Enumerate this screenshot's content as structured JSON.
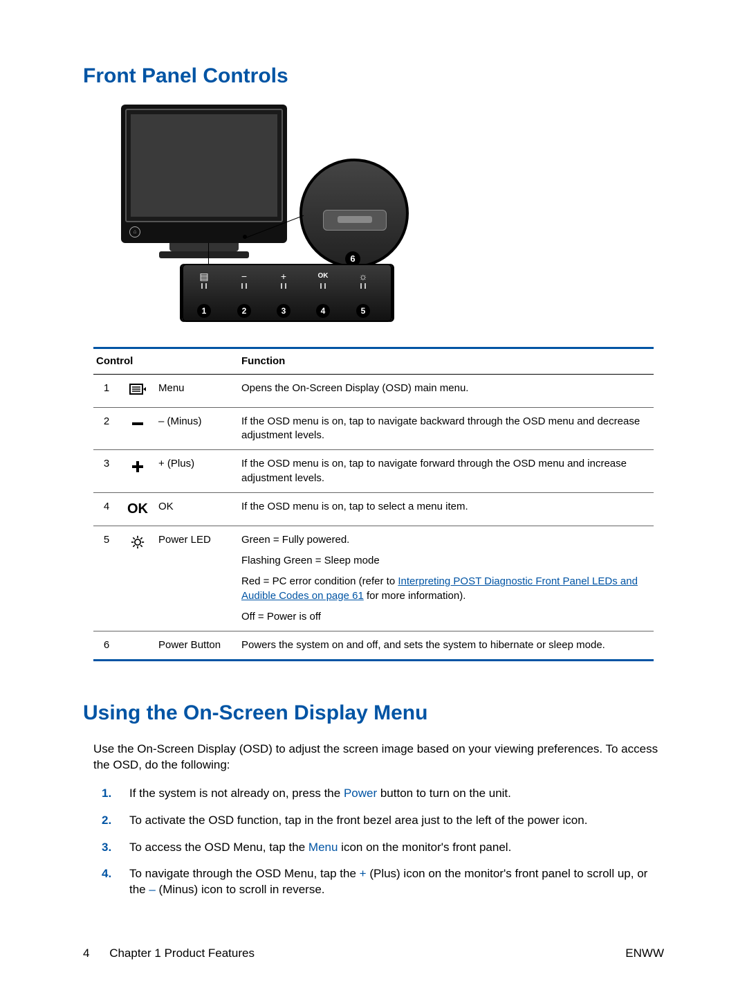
{
  "headings": {
    "h1": "Front Panel Controls",
    "h2": "Using the On-Screen Display Menu"
  },
  "figure": {
    "badges": [
      "1",
      "2",
      "3",
      "4",
      "5",
      "6"
    ],
    "strip_glyphs": [
      "menu",
      "−",
      "+",
      "OK",
      "power-led"
    ]
  },
  "table": {
    "headers": {
      "control": "Control",
      "function": "Function"
    },
    "rows": [
      {
        "num": "1",
        "icon": "menu-icon",
        "name": "Menu",
        "functions": [
          "Opens the On-Screen Display (OSD) main menu."
        ]
      },
      {
        "num": "2",
        "icon": "minus-icon",
        "name": "– (Minus)",
        "functions": [
          "If the OSD menu is on, tap to navigate backward through the OSD menu and decrease adjustment levels."
        ]
      },
      {
        "num": "3",
        "icon": "plus-icon",
        "name": "+ (Plus)",
        "functions": [
          "If the OSD menu is on, tap to navigate forward through the OSD menu and increase adjustment levels."
        ]
      },
      {
        "num": "4",
        "icon": "ok-icon",
        "icon_text": "OK",
        "name": "OK",
        "functions": [
          "If the OSD menu is on, tap to select a menu item."
        ]
      },
      {
        "num": "5",
        "icon": "power-led-icon",
        "name": "Power LED",
        "functions": [
          "Green = Fully powered.",
          "Flashing Green = Sleep mode",
          "",
          "Off = Power is off"
        ],
        "linked_function": {
          "pre": "Red = PC error condition (refer to ",
          "link": "Interpreting POST Diagnostic Front Panel LEDs and Audible Codes on page 61",
          "post": " for more information)."
        }
      },
      {
        "num": "6",
        "icon": "",
        "name": "Power Button",
        "functions": [
          "Powers the system on and off, and sets the system to hibernate or sleep mode."
        ]
      }
    ]
  },
  "osd": {
    "intro": "Use the On-Screen Display (OSD) to adjust the screen image based on your viewing preferences. To access the OSD, do the following:",
    "steps": [
      {
        "pre": "If the system is not already on, press the ",
        "kw": "Power",
        "post": " button to turn on the unit."
      },
      {
        "pre": "To activate the OSD function, tap in the front bezel area just to the left of the power icon.",
        "kw": "",
        "post": ""
      },
      {
        "pre": "To access the OSD Menu, tap the ",
        "kw": "Menu",
        "post": " icon on the monitor's front panel."
      },
      {
        "pre": "To navigate through the OSD Menu, tap the ",
        "kw": "+",
        "post": " (Plus) icon on the monitor's front panel to scroll up, or the ",
        "kw2": "–",
        "post2": " (Minus) icon to scroll in reverse."
      }
    ]
  },
  "footer": {
    "page": "4",
    "chapter": "Chapter 1   Product Features",
    "right": "ENWW"
  }
}
